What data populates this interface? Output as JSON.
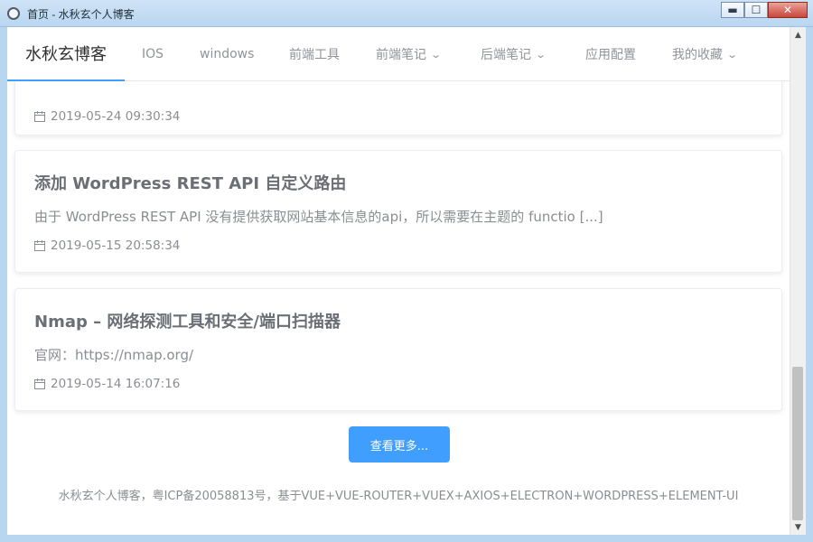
{
  "window": {
    "title": "首页 - 水秋玄个人博客",
    "icon": "app-logo-icon",
    "controls": {
      "minimize": "▬",
      "maximize": "☐",
      "close": "✕"
    }
  },
  "nav": {
    "brand": "水秋玄博客",
    "items": [
      {
        "label": "IOS",
        "has_dropdown": false
      },
      {
        "label": "windows",
        "has_dropdown": false
      },
      {
        "label": "前端工具",
        "has_dropdown": false
      },
      {
        "label": "前端笔记",
        "has_dropdown": true
      },
      {
        "label": "后端笔记",
        "has_dropdown": true
      },
      {
        "label": "应用配置",
        "has_dropdown": false
      },
      {
        "label": "我的收藏",
        "has_dropdown": true
      }
    ],
    "chevron_glyph": "⌄"
  },
  "posts": [
    {
      "title": "",
      "excerpt": "",
      "date": "2019-05-24 09:30:34"
    },
    {
      "title": "添加 WordPress REST API 自定义路由",
      "excerpt": "由于 WordPress REST API 没有提供获取网站基本信息的api，所以需要在主题的 functio [...]",
      "date": "2019-05-15 20:58:34"
    },
    {
      "title": "Nmap – 网络探测工具和安全/端口扫描器",
      "excerpt": "官网：https://nmap.org/",
      "date": "2019-05-14 16:07:16"
    }
  ],
  "more_button": "查看更多...",
  "footer": "水秋玄个人博客，粤ICP备20058813号，基于VUE+VUE-ROUTER+VUEX+AXIOS+ELECTRON+WORDPRESS+ELEMENT-UI",
  "scrollbar": {
    "up": "▲",
    "down": "▼"
  },
  "colors": {
    "accent": "#409eff",
    "text_muted": "#8a8d93",
    "title": "#6b6f75"
  }
}
